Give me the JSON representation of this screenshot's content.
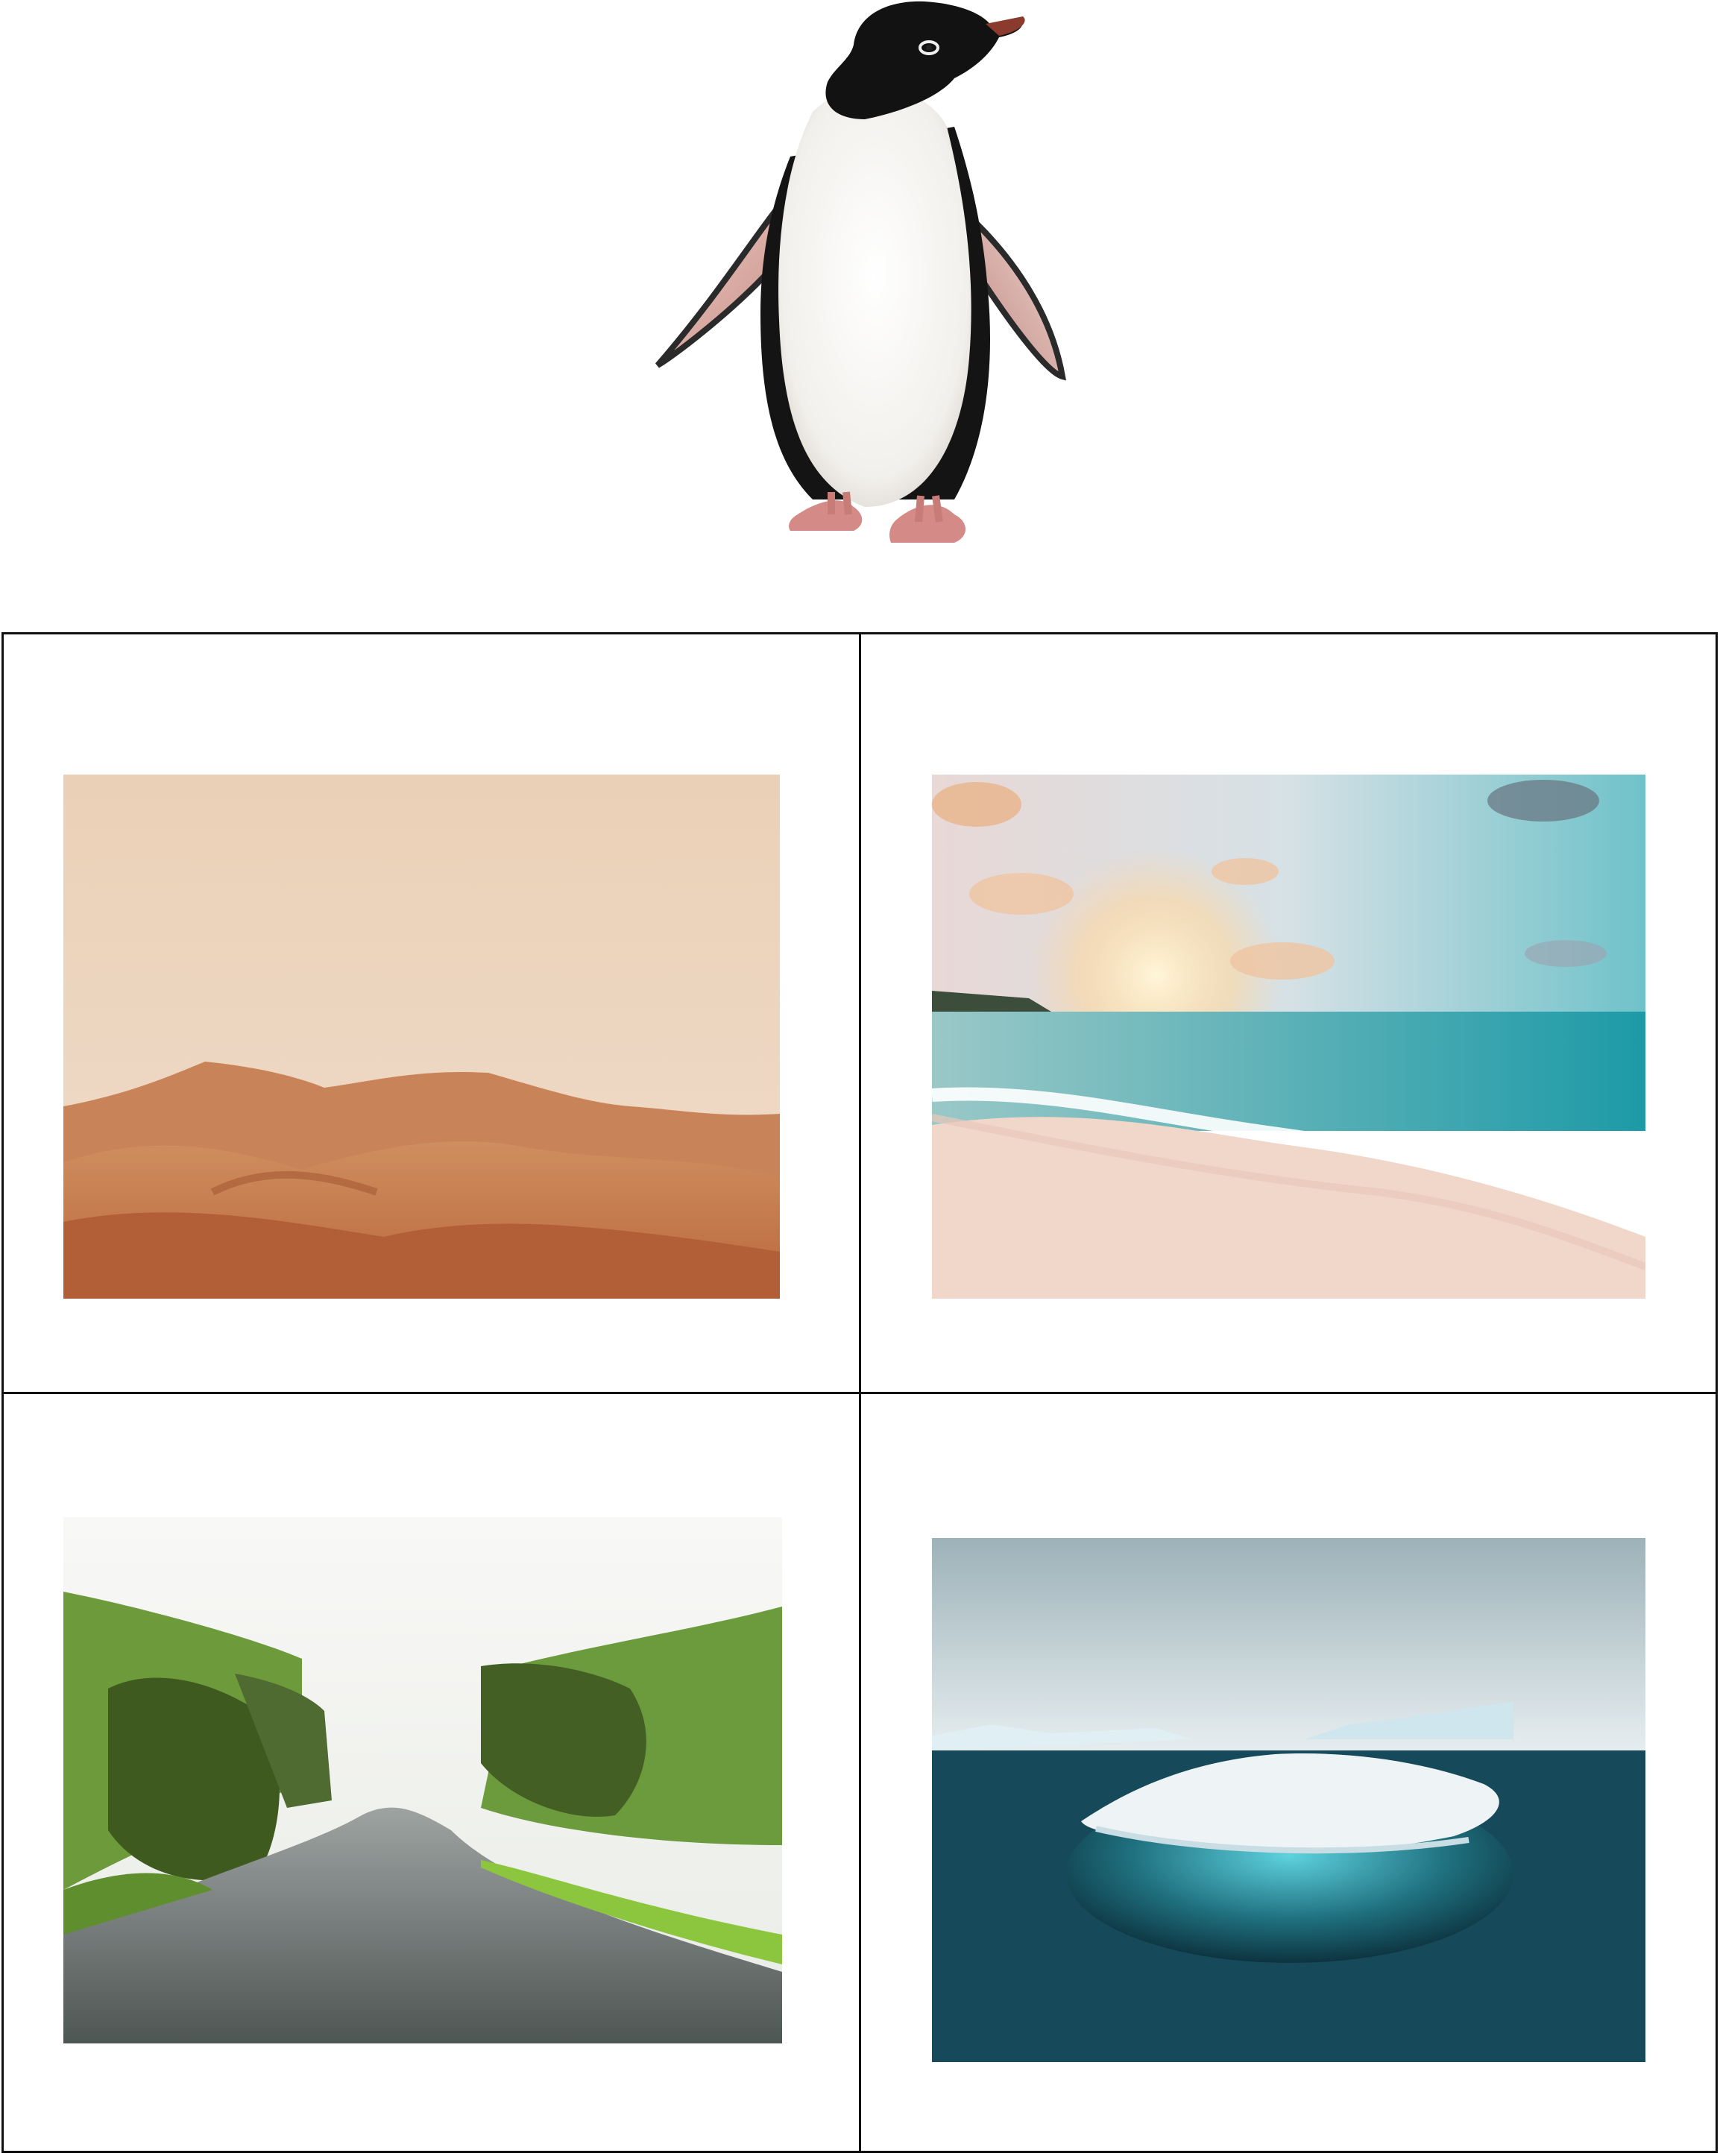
{
  "scene": {
    "top_image": {
      "subject": "penguin"
    },
    "options": [
      {
        "subject": "desert"
      },
      {
        "subject": "beach"
      },
      {
        "subject": "river-canyon"
      },
      {
        "subject": "iceberg"
      }
    ]
  },
  "colors": {
    "grid_border": "#111111",
    "background": "#ffffff"
  }
}
